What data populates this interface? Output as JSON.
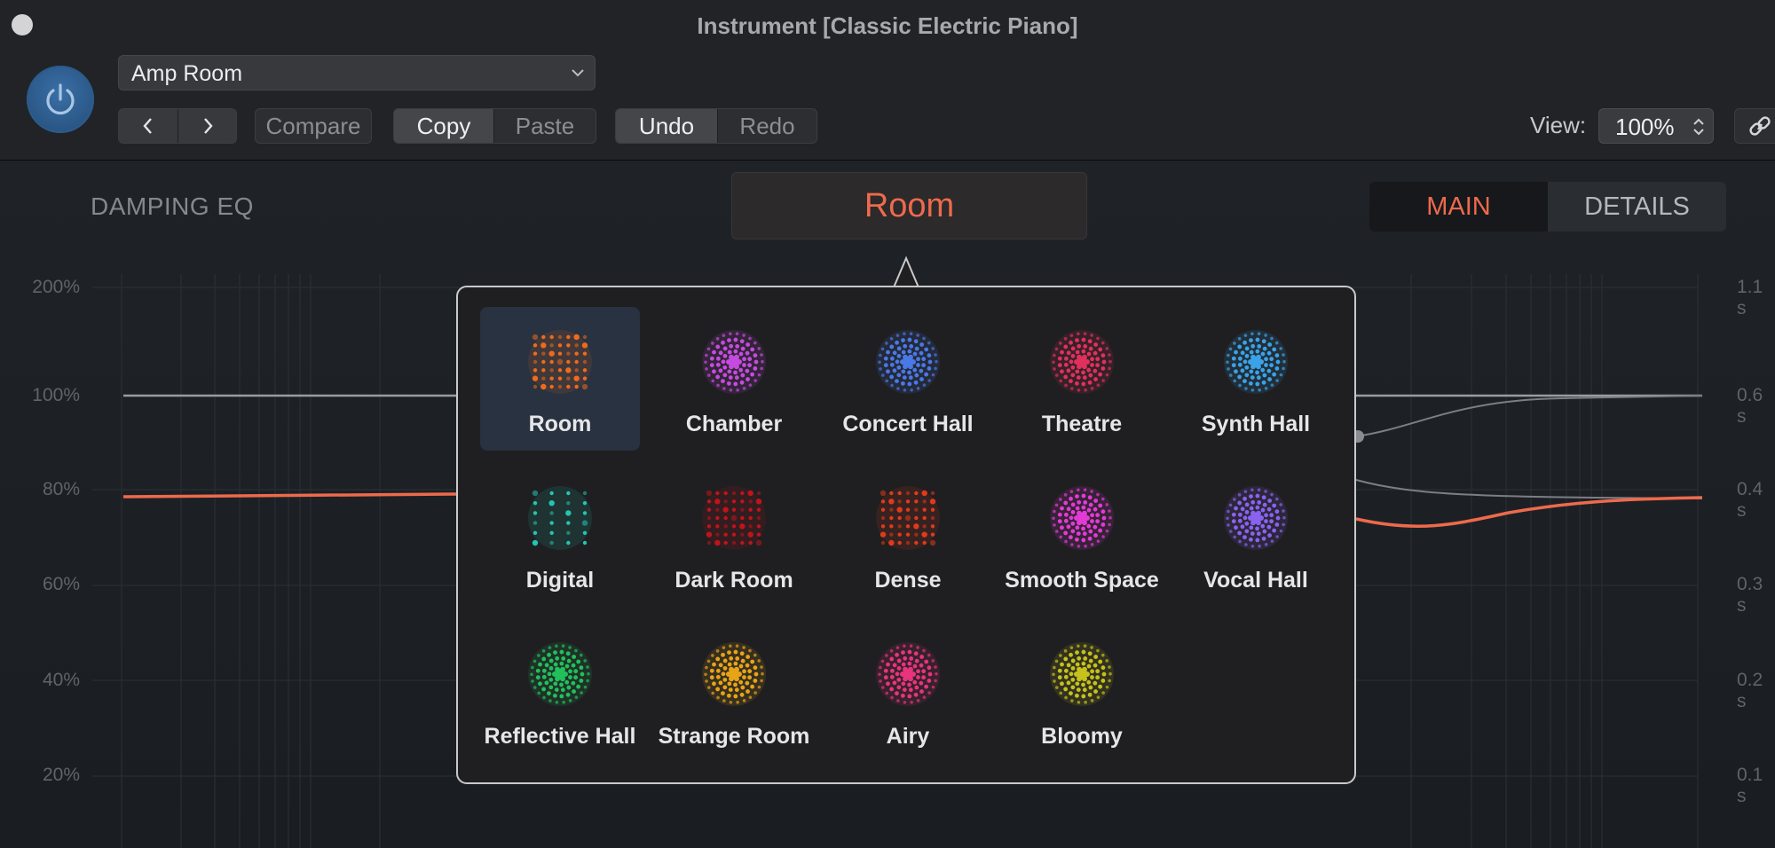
{
  "window": {
    "title": "Instrument [Classic Electric Piano]"
  },
  "header": {
    "preset_value": "Amp Room",
    "prev_label": "‹",
    "next_label": "›",
    "compare_label": "Compare",
    "copy_label": "Copy",
    "paste_label": "Paste",
    "undo_label": "Undo",
    "redo_label": "Redo",
    "view_label": "View:",
    "view_value": "100%"
  },
  "plugin": {
    "damping_title": "DAMPING EQ",
    "room_button": "Room",
    "tabs": {
      "main": "MAIN",
      "details": "DETAILS"
    },
    "y_axis_left": [
      "200%",
      "100%",
      "80%",
      "60%",
      "40%",
      "20%"
    ],
    "y_axis_right": [
      "1.1 s",
      "0.6 s",
      "0.4 s",
      "0.3 s",
      "0.2 s",
      "0.1 s"
    ]
  },
  "colors": {
    "accent": "#ee6a4c",
    "selected_bg": "#283240"
  },
  "room_types": [
    {
      "label": "Room",
      "icon": "room-icon",
      "color": "#ef6b1a"
    },
    {
      "label": "Chamber",
      "icon": "chamber-icon",
      "color": "#c54be0"
    },
    {
      "label": "Concert Hall",
      "icon": "concert-hall-icon",
      "color": "#4a78e6"
    },
    {
      "label": "Theatre",
      "icon": "theatre-icon",
      "color": "#e0305d"
    },
    {
      "label": "Synth Hall",
      "icon": "synth-hall-icon",
      "color": "#3aa2e8"
    },
    {
      "label": "Digital",
      "icon": "digital-icon",
      "color": "#22c6b2"
    },
    {
      "label": "Dark Room",
      "icon": "dark-room-icon",
      "color": "#c0141a"
    },
    {
      "label": "Dense",
      "icon": "dense-icon",
      "color": "#e03a1a"
    },
    {
      "label": "Smooth Space",
      "icon": "smooth-space-icon",
      "color": "#e33ad6"
    },
    {
      "label": "Vocal Hall",
      "icon": "vocal-hall-icon",
      "color": "#8a62f0"
    },
    {
      "label": "Reflective Hall",
      "icon": "reflective-hall-icon",
      "color": "#22c05a"
    },
    {
      "label": "Strange Room",
      "icon": "strange-room-icon",
      "color": "#e7a416"
    },
    {
      "label": "Airy",
      "icon": "airy-icon",
      "color": "#e8337d"
    },
    {
      "label": "Bloomy",
      "icon": "bloomy-icon",
      "color": "#c6c11b"
    }
  ]
}
